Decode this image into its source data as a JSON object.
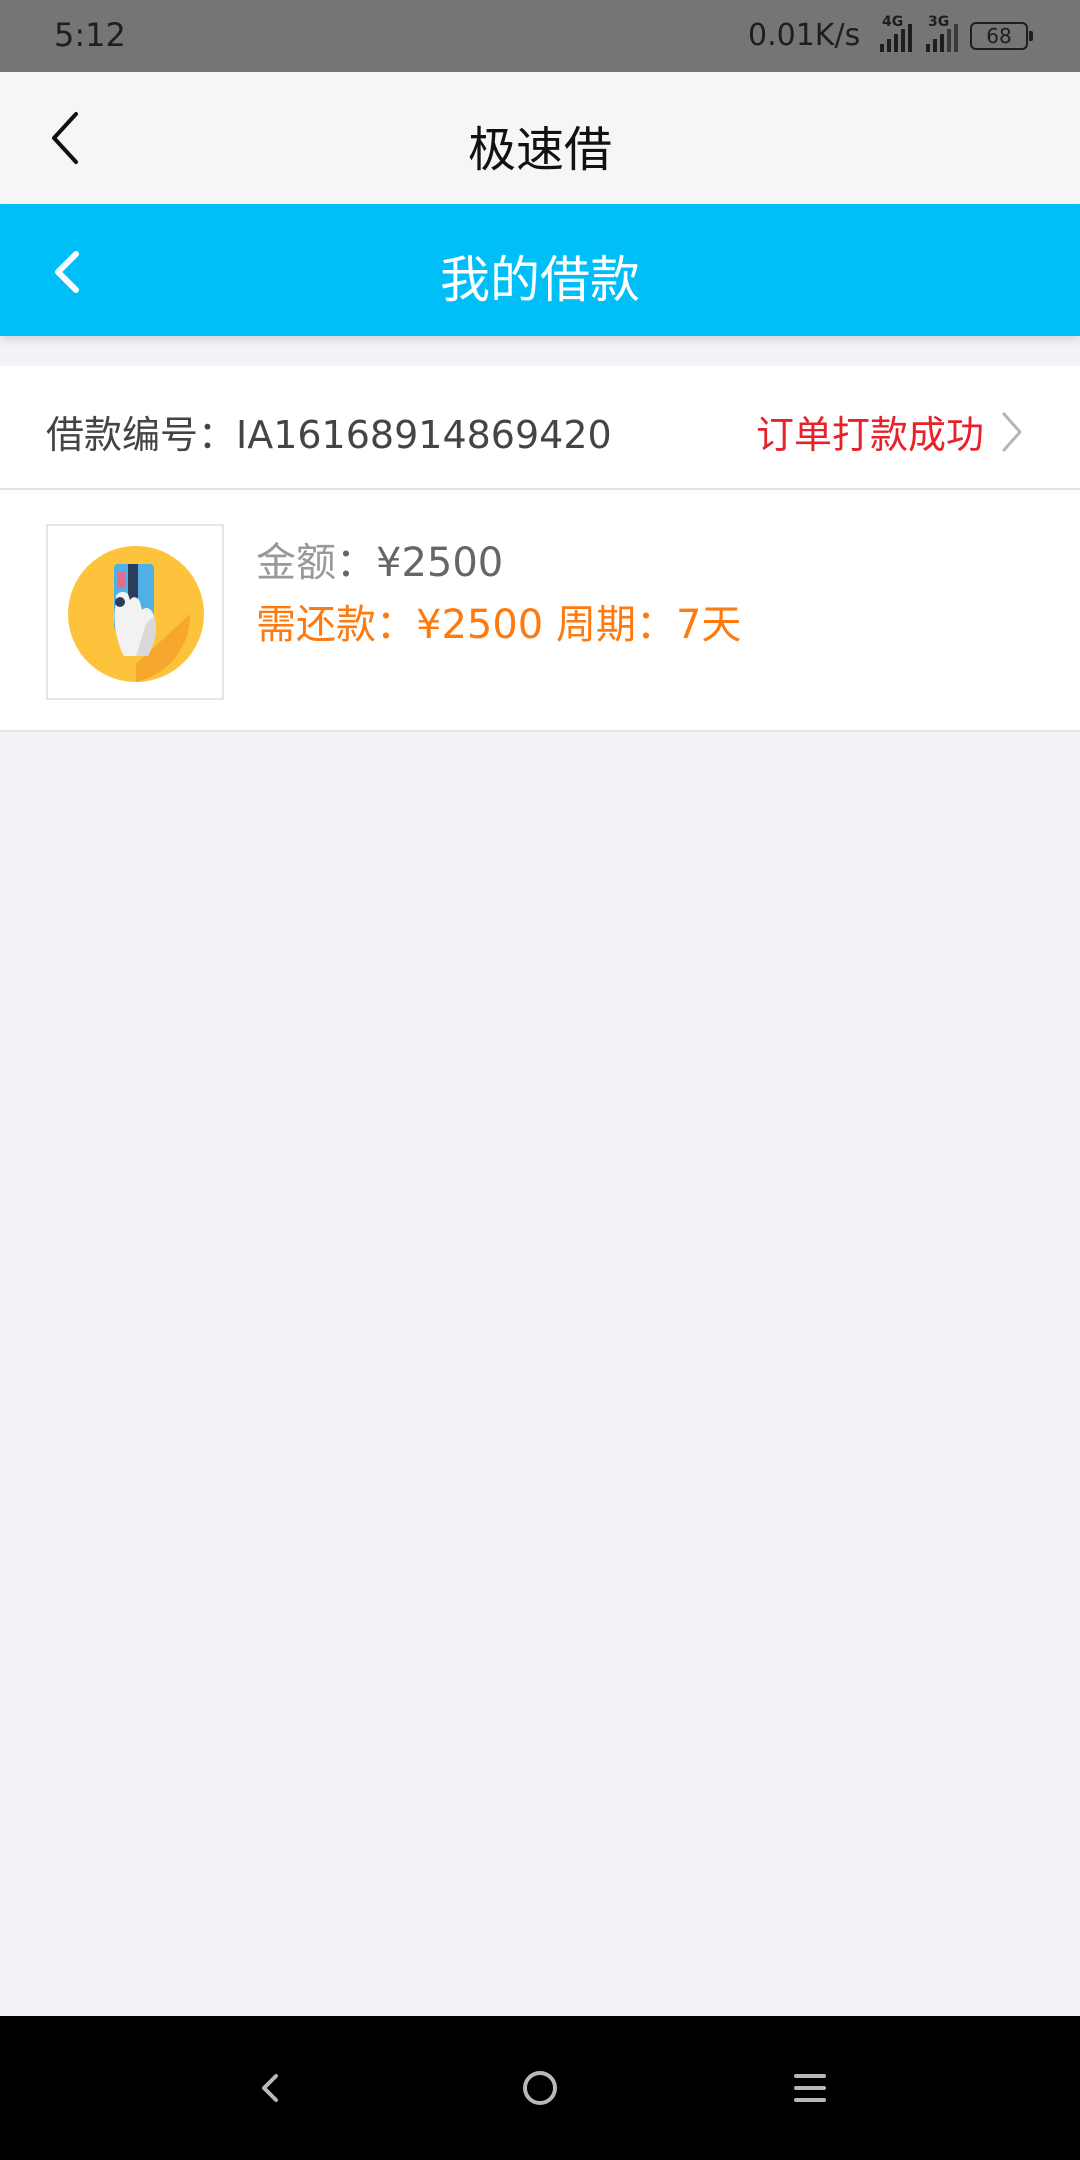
{
  "status_bar": {
    "time": "5:12",
    "net_speed": "0.01K/s",
    "signal1_label": "4G",
    "signal2_label": "3G",
    "battery": "68"
  },
  "app_header": {
    "title": "极速借",
    "back_icon": "chevron-left-icon"
  },
  "page_header": {
    "title": "我的借款",
    "back_icon": "chevron-left-icon",
    "color": "#00bff8"
  },
  "loan": {
    "number_label": "借款编号：IA16168914869420",
    "status": "订单打款成功",
    "status_color": "#e8212a",
    "amount_key": "金额",
    "amount_value": "：¥2500",
    "repay_line": "需还款：¥2500 周期：7天",
    "repay_color": "#ff7a0e",
    "thumb_icon": "credit-card-hand-icon"
  },
  "nav_bar": {
    "back_icon": "nav-back-icon",
    "home_icon": "nav-home-icon",
    "menu_icon": "nav-menu-icon"
  }
}
